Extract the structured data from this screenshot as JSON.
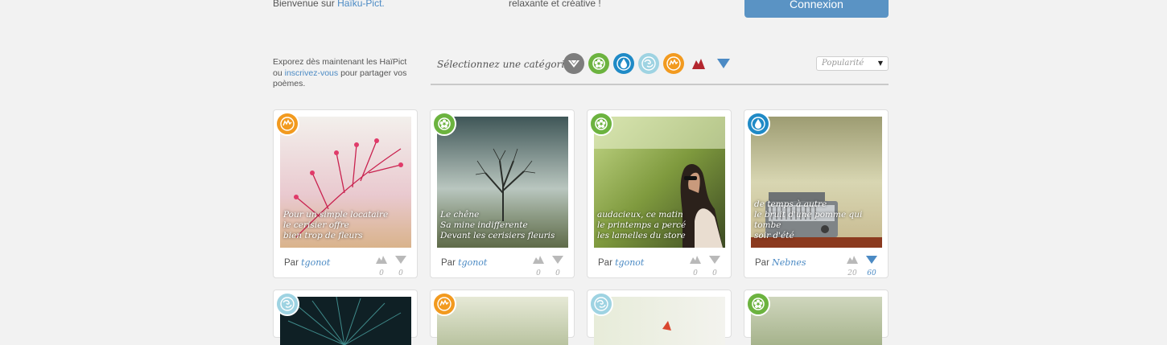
{
  "header": {
    "welcome_prefix": "Bienvenue sur",
    "welcome_link": "Haïku-Pict.",
    "relax_text": "relaxante et créative !",
    "login_label": "Connexion"
  },
  "intro": {
    "line_prefix": "Exporez dès maintenant les HaïPict ou",
    "link": "inscrivez-vous",
    "line_suffix": "pour partager vos poèmes."
  },
  "categories": {
    "label": "Sélectionnez une catégorie :",
    "items": [
      {
        "icon": "all-icon",
        "color": "#7d7d7d"
      },
      {
        "icon": "flower-icon",
        "color": "#6cb33f"
      },
      {
        "icon": "water-drop-icon",
        "color": "#1f8ac6"
      },
      {
        "icon": "wind-icon",
        "color": "#9ed3e2"
      },
      {
        "icon": "sun-icon",
        "color": "#f29a1f"
      }
    ],
    "vote_up_color": "#b3262e",
    "vote_down_color": "#4b8ac4"
  },
  "sort": {
    "selected": "Popularité"
  },
  "cards": [
    {
      "category": "sun-icon",
      "badge_color": "#f29a1f",
      "poem": [
        "Pour un simple locataire",
        "le cerisier offre",
        "bien trop de fleurs"
      ],
      "by": "Par",
      "author": "tgonot",
      "up": "0",
      "down": "0",
      "down_active": false
    },
    {
      "category": "flower-icon",
      "badge_color": "#6cb33f",
      "poem": [
        "Le chêne",
        "Sa mine indifferente",
        "Devant les cerisiers fleuris"
      ],
      "by": "Par",
      "author": "tgonot",
      "up": "0",
      "down": "0",
      "down_active": false
    },
    {
      "category": "flower-icon",
      "badge_color": "#6cb33f",
      "poem": [
        "audacieux, ce matin",
        "le printemps a percé",
        "les lamelles du store"
      ],
      "by": "Par",
      "author": "tgonot",
      "up": "0",
      "down": "0",
      "down_active": false
    },
    {
      "category": "water-drop-icon",
      "badge_color": "#1f8ac6",
      "poem": [
        "de temps à autre",
        "le bruit d'une pomme qui tombe",
        "soir d'été"
      ],
      "by": "Par",
      "author": "Nebnes",
      "up": "20",
      "down": "60",
      "down_active": true
    }
  ],
  "row2_badges": [
    "#9ed3e2",
    "#f29a1f",
    "#9ed3e2",
    "#6cb33f"
  ]
}
